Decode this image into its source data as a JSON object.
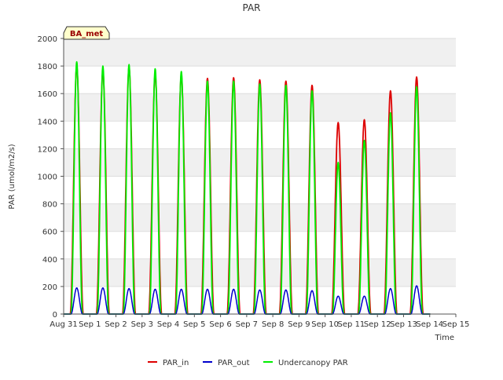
{
  "chart_data": {
    "type": "line",
    "title": "PAR",
    "xlabel": "Time",
    "ylabel": "PAR (umol/m2/s)",
    "badge": "BA_met",
    "xlim": [
      0,
      15
    ],
    "ylim": [
      0,
      2000
    ],
    "x_tick_values": [
      0,
      1,
      2,
      3,
      4,
      5,
      6,
      7,
      8,
      9,
      10,
      11,
      12,
      13,
      14,
      15
    ],
    "x_tick_labels": [
      "Aug 31",
      "Sep 1",
      "Sep 2",
      "Sep 3",
      "Sep 4",
      "Sep 5",
      "Sep 6",
      "Sep 7",
      "Sep 8",
      "Sep 9",
      "Sep 10",
      "Sep 11",
      "Sep 12",
      "Sep 13",
      "Sep 14",
      "Sep 15"
    ],
    "y_ticks": [
      0,
      200,
      400,
      600,
      800,
      1000,
      1200,
      1400,
      1600,
      1800,
      2000
    ],
    "grid": true,
    "legend_position": "bottom",
    "colors": {
      "PAR_in": "#dd0000",
      "PAR_out": "#0000cc",
      "Undercanopy PAR": "#00ee00"
    },
    "series": [
      {
        "name": "PAR_in",
        "day_centers": [
          0.5,
          1.5,
          2.5,
          3.5,
          4.5,
          5.5,
          6.5,
          7.5,
          8.5,
          9.5,
          10.5,
          11.5,
          12.5,
          13.5
        ],
        "daily_peaks": [
          1800,
          1760,
          1790,
          1740,
          1730,
          1710,
          1715,
          1700,
          1690,
          1660,
          1390,
          1410,
          1620,
          1720
        ]
      },
      {
        "name": "PAR_out",
        "day_centers": [
          0.5,
          1.5,
          2.5,
          3.5,
          4.5,
          5.5,
          6.5,
          7.5,
          8.5,
          9.5,
          10.5,
          11.5,
          12.5,
          13.5
        ],
        "daily_peaks": [
          190,
          190,
          185,
          180,
          180,
          180,
          180,
          175,
          175,
          170,
          130,
          130,
          185,
          205
        ]
      },
      {
        "name": "Undercanopy PAR",
        "day_centers": [
          0.5,
          1.5,
          2.5,
          3.5,
          4.5,
          5.5,
          6.5,
          7.5,
          8.5,
          9.5,
          10.5,
          11.5,
          12.5,
          13.5
        ],
        "daily_peaks": [
          1830,
          1800,
          1810,
          1780,
          1760,
          1690,
          1690,
          1670,
          1660,
          1620,
          1100,
          1260,
          1460,
          1650
        ]
      }
    ]
  }
}
